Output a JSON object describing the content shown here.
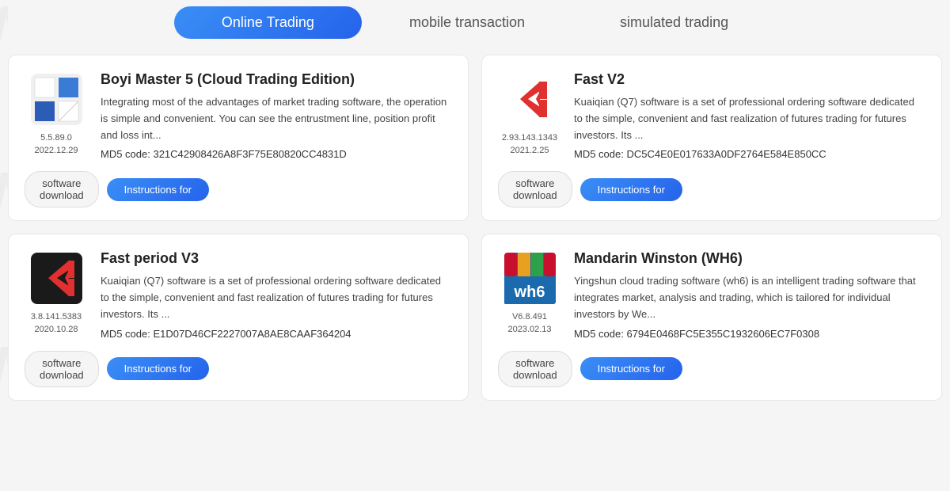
{
  "tabs": [
    {
      "id": "online",
      "label": "Online Trading",
      "active": true
    },
    {
      "id": "mobile",
      "label": "mobile transaction",
      "active": false
    },
    {
      "id": "simulated",
      "label": "simulated trading",
      "active": false
    }
  ],
  "cards": [
    {
      "id": "boyi",
      "title": "Boyi Master 5 (Cloud Trading Edition)",
      "description": "Integrating most of the advantages of market trading software, the operation is simple and convenient. You can see the entrustment line, position profit and loss int...",
      "md5": "MD5 code: 321C42908426A8F3F75E80820CC4831D",
      "version": "5.5.89.0",
      "date": "2022.12.29",
      "software_btn": "software\ndownload",
      "instructions_btn": "Instructions for",
      "logo_type": "boyi"
    },
    {
      "id": "fastv2",
      "title": "Fast V2",
      "description": "Kuaiqian (Q7) software is a set of professional ordering software dedicated to the simple, convenient and fast realization of futures trading for futures investors. Its ...",
      "md5": "MD5 code: DC5C4E0E017633A0DF2764E584E850CC",
      "version": "2.93.143.1343",
      "date": "2021.2.25",
      "software_btn": "software\ndownload",
      "instructions_btn": "Instructions for",
      "logo_type": "fastv2"
    },
    {
      "id": "fastv3",
      "title": "Fast period V3",
      "description": "Kuaiqian (Q7) software is a set of professional ordering software dedicated to the simple, convenient and fast realization of futures trading for futures investors. Its ...",
      "md5": "MD5 code: E1D07D46CF2227007A8AE8CAAF364204",
      "version": "3.8.141.5383",
      "date": "2020.10.28",
      "software_btn": "software\ndownload",
      "instructions_btn": "Instructions for",
      "logo_type": "fastv3"
    },
    {
      "id": "mandarin",
      "title": "Mandarin Winston (WH6)",
      "description": "Yingshun cloud trading software (wh6) is an intelligent trading software that integrates market, analysis and trading, which is tailored for individual investors by We...",
      "md5": "MD5 code: 6794E0468FC5E355C1932606EC7F0308",
      "version": "V6.8.491",
      "date": "2023.02.13",
      "software_btn": "software\ndownload",
      "instructions_btn": "Instructions for",
      "logo_type": "wh6"
    }
  ],
  "watermarks": [
    "WikiFX",
    "WikiFX",
    "WikiFX"
  ]
}
